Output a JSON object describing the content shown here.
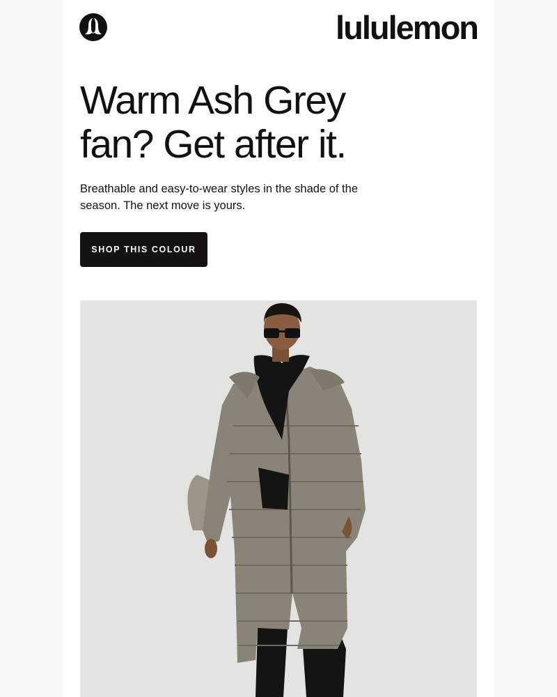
{
  "brand": {
    "wordmark": "lululemon",
    "logo_icon": "lululemon-logo-icon"
  },
  "hero_text": {
    "headline_line1": "Warm Ash Grey",
    "headline_line2": "fan? Get after it.",
    "body": "Breathable and easy-to-wear styles in the shade of the season. The next move is yours."
  },
  "cta": {
    "label": "SHOP THIS COLOUR"
  },
  "hero_image": {
    "icon": "model-in-long-puffer-coat-photo",
    "background_color": "#e3e3e2",
    "coat_color": "#8a8478"
  },
  "colors": {
    "page_background": "#f7f7f5",
    "text": "#111111",
    "button": "#161211"
  }
}
